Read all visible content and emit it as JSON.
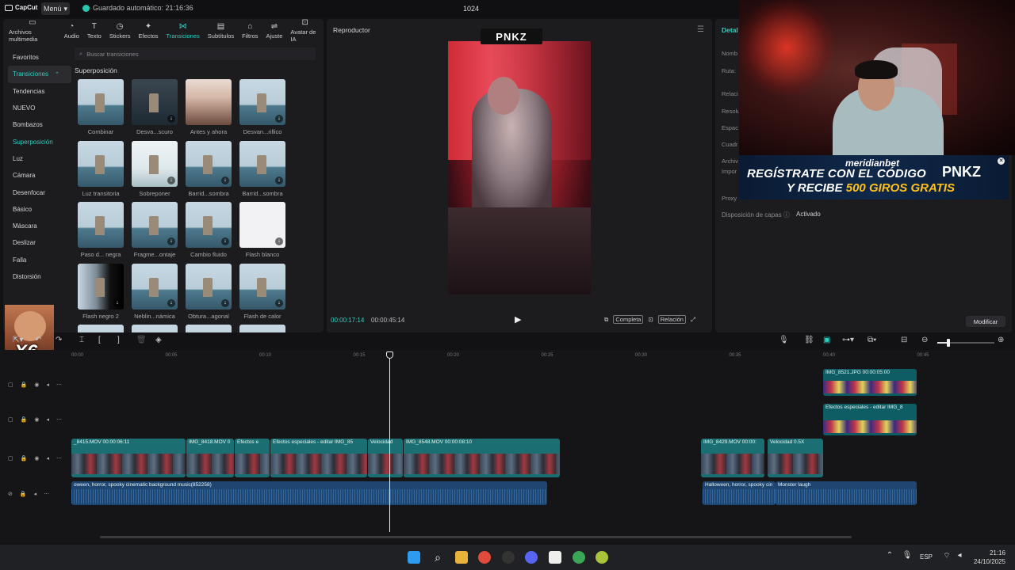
{
  "app": {
    "logo": "CapCut",
    "menu_label": "Menú",
    "autosave": "Guardado automático: 21:16:36",
    "project": "1024"
  },
  "tabs": [
    {
      "label": "Archivos multimedia",
      "icon": "▭"
    },
    {
      "label": "Audio",
      "icon": "◔"
    },
    {
      "label": "Texto",
      "icon": "T"
    },
    {
      "label": "Stickers",
      "icon": "◷"
    },
    {
      "label": "Efectos",
      "icon": "✦"
    },
    {
      "label": "Transiciones",
      "icon": "⋈"
    },
    {
      "label": "Subtítulos",
      "icon": "▤"
    },
    {
      "label": "Filtros",
      "icon": "⌂"
    },
    {
      "label": "Ajuste",
      "icon": "⇌"
    },
    {
      "label": "Avatar de IA",
      "icon": "⊡"
    }
  ],
  "categories": [
    "Favoritos",
    "Transiciones",
    "Tendencias",
    "NUEVO",
    "Bombazos",
    "Superposición",
    "Luz",
    "Cámara",
    "Desenfocar",
    "Básico",
    "Máscara",
    "Deslizar",
    "Falla",
    "Distorsión"
  ],
  "search_placeholder": "Buscar transiciones",
  "section_title": "Superposición",
  "transitions": [
    {
      "label": "Combinar",
      "style": "normal",
      "dl": false
    },
    {
      "label": "Desva...scuro",
      "style": "dim",
      "dl": true
    },
    {
      "label": "Antes y ahora",
      "style": "face",
      "dl": false
    },
    {
      "label": "Desvan...rillico",
      "style": "normal",
      "dl": true
    },
    {
      "label": "Luz transitoria",
      "style": "normal",
      "dl": false
    },
    {
      "label": "Sobreponer",
      "style": "blurred",
      "dl": true
    },
    {
      "label": "Barrid...sombra",
      "style": "normal",
      "dl": true
    },
    {
      "label": "Barrid...sombra",
      "style": "normal",
      "dl": true
    },
    {
      "label": "Paso d... negra",
      "style": "normal",
      "dl": false
    },
    {
      "label": "Fragme...ontaje",
      "style": "normal",
      "dl": true
    },
    {
      "label": "Cambio fluido",
      "style": "normal",
      "dl": true
    },
    {
      "label": "Flash blanco",
      "style": "white",
      "dl": true
    },
    {
      "label": "Flash negro 2",
      "style": "dark",
      "dl": true
    },
    {
      "label": "Neblin...námica",
      "style": "normal",
      "dl": true
    },
    {
      "label": "Obtura...agonal",
      "style": "normal",
      "dl": true
    },
    {
      "label": "Flash de calor",
      "style": "normal",
      "dl": true
    },
    {
      "label": "",
      "style": "normal",
      "dl": false
    },
    {
      "label": "",
      "style": "normal",
      "dl": false
    },
    {
      "label": "",
      "style": "normal",
      "dl": false
    },
    {
      "label": "",
      "style": "normal",
      "dl": false
    }
  ],
  "player": {
    "title": "Reproductor",
    "badge": "PNKZ",
    "time_current": "00:00:17:14",
    "time_total": "00:00:45:14",
    "btn_full": "Completa",
    "btn_ratio": "Relación"
  },
  "details": {
    "title": "Detal",
    "labels": [
      "Nomb",
      "Ruta:",
      "Relaci",
      "Resolu",
      "Espac",
      "Cuadr",
      "Archiv",
      "Impor",
      "Proxy"
    ],
    "layer_label": "Disposición de capas",
    "layer_value": "Activado",
    "modify": "Modificar"
  },
  "banner": {
    "brand": "meridianbet",
    "line1": "REGÍSTRATE CON EL CÓDIGO",
    "code": "PNKZ",
    "line2_a": "Y RECIBE",
    "line2_b": "500 GIROS GRATIS"
  },
  "meme_text": "X6",
  "ruler_ticks": [
    "00:00",
    "00:05",
    "00:10",
    "00:15",
    "00:20",
    "00:25",
    "00:30",
    "00:35",
    "00:40",
    "00:45"
  ],
  "clips": {
    "overlay_top": "IMG_8521.JPG  00:00:05:00",
    "overlay_fx": "Efectos especiales - editar  IMG_8",
    "main_1": "_8415.MOV  00:00:06:11",
    "main_2": "IMG_8418.MOV  0",
    "main_3": "Efectos e",
    "main_4": "Efectos especiales - editar  IMG_85",
    "main_5": "Velocidad",
    "main_6": "IMG_8548.MOV  00:00:08:10",
    "main_7": "IMG_8429.MOV  00:00:",
    "main_8": "Velocidad 0.5X",
    "audio_1": "oween, horror, spooky cinematic background music(852258)",
    "audio_2": "Halloween, horror, spooky cin",
    "audio_3": "Monster laugh"
  },
  "taskbar": {
    "lang": "ESP",
    "time": "21:16",
    "date": "24/10/2025"
  }
}
